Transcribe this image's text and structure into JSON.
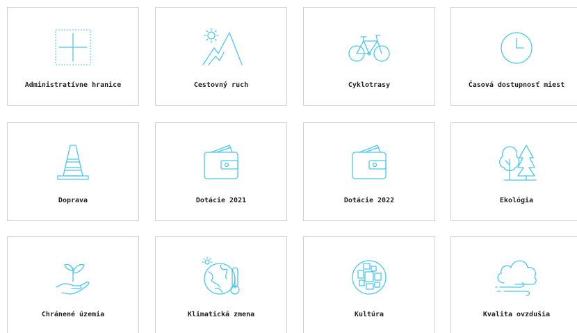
{
  "colors": {
    "icon": "#4cc7ea",
    "border": "#cfcfcf",
    "text": "#222222"
  },
  "tiles": [
    {
      "label": "Administratívne hranice",
      "icon": "boundary-cross-icon"
    },
    {
      "label": "Cestovný ruch",
      "icon": "mountain-sun-icon"
    },
    {
      "label": "Cyklotrasy",
      "icon": "bicycle-icon"
    },
    {
      "label": "Časová dostupnosť miest",
      "icon": "clock-icon"
    },
    {
      "label": "Doprava",
      "icon": "traffic-cone-icon"
    },
    {
      "label": "Dotácie 2021",
      "icon": "wallet-icon"
    },
    {
      "label": "Dotácie 2022",
      "icon": "wallet-icon"
    },
    {
      "label": "Ekológia",
      "icon": "trees-icon"
    },
    {
      "label": "Chránené územia",
      "icon": "hand-plant-icon"
    },
    {
      "label": "Klimatická zmena",
      "icon": "globe-thermometer-icon"
    },
    {
      "label": "Kultúra",
      "icon": "culture-tiles-icon"
    },
    {
      "label": "Kvalita ovzdušia",
      "icon": "cloud-wind-icon"
    }
  ]
}
